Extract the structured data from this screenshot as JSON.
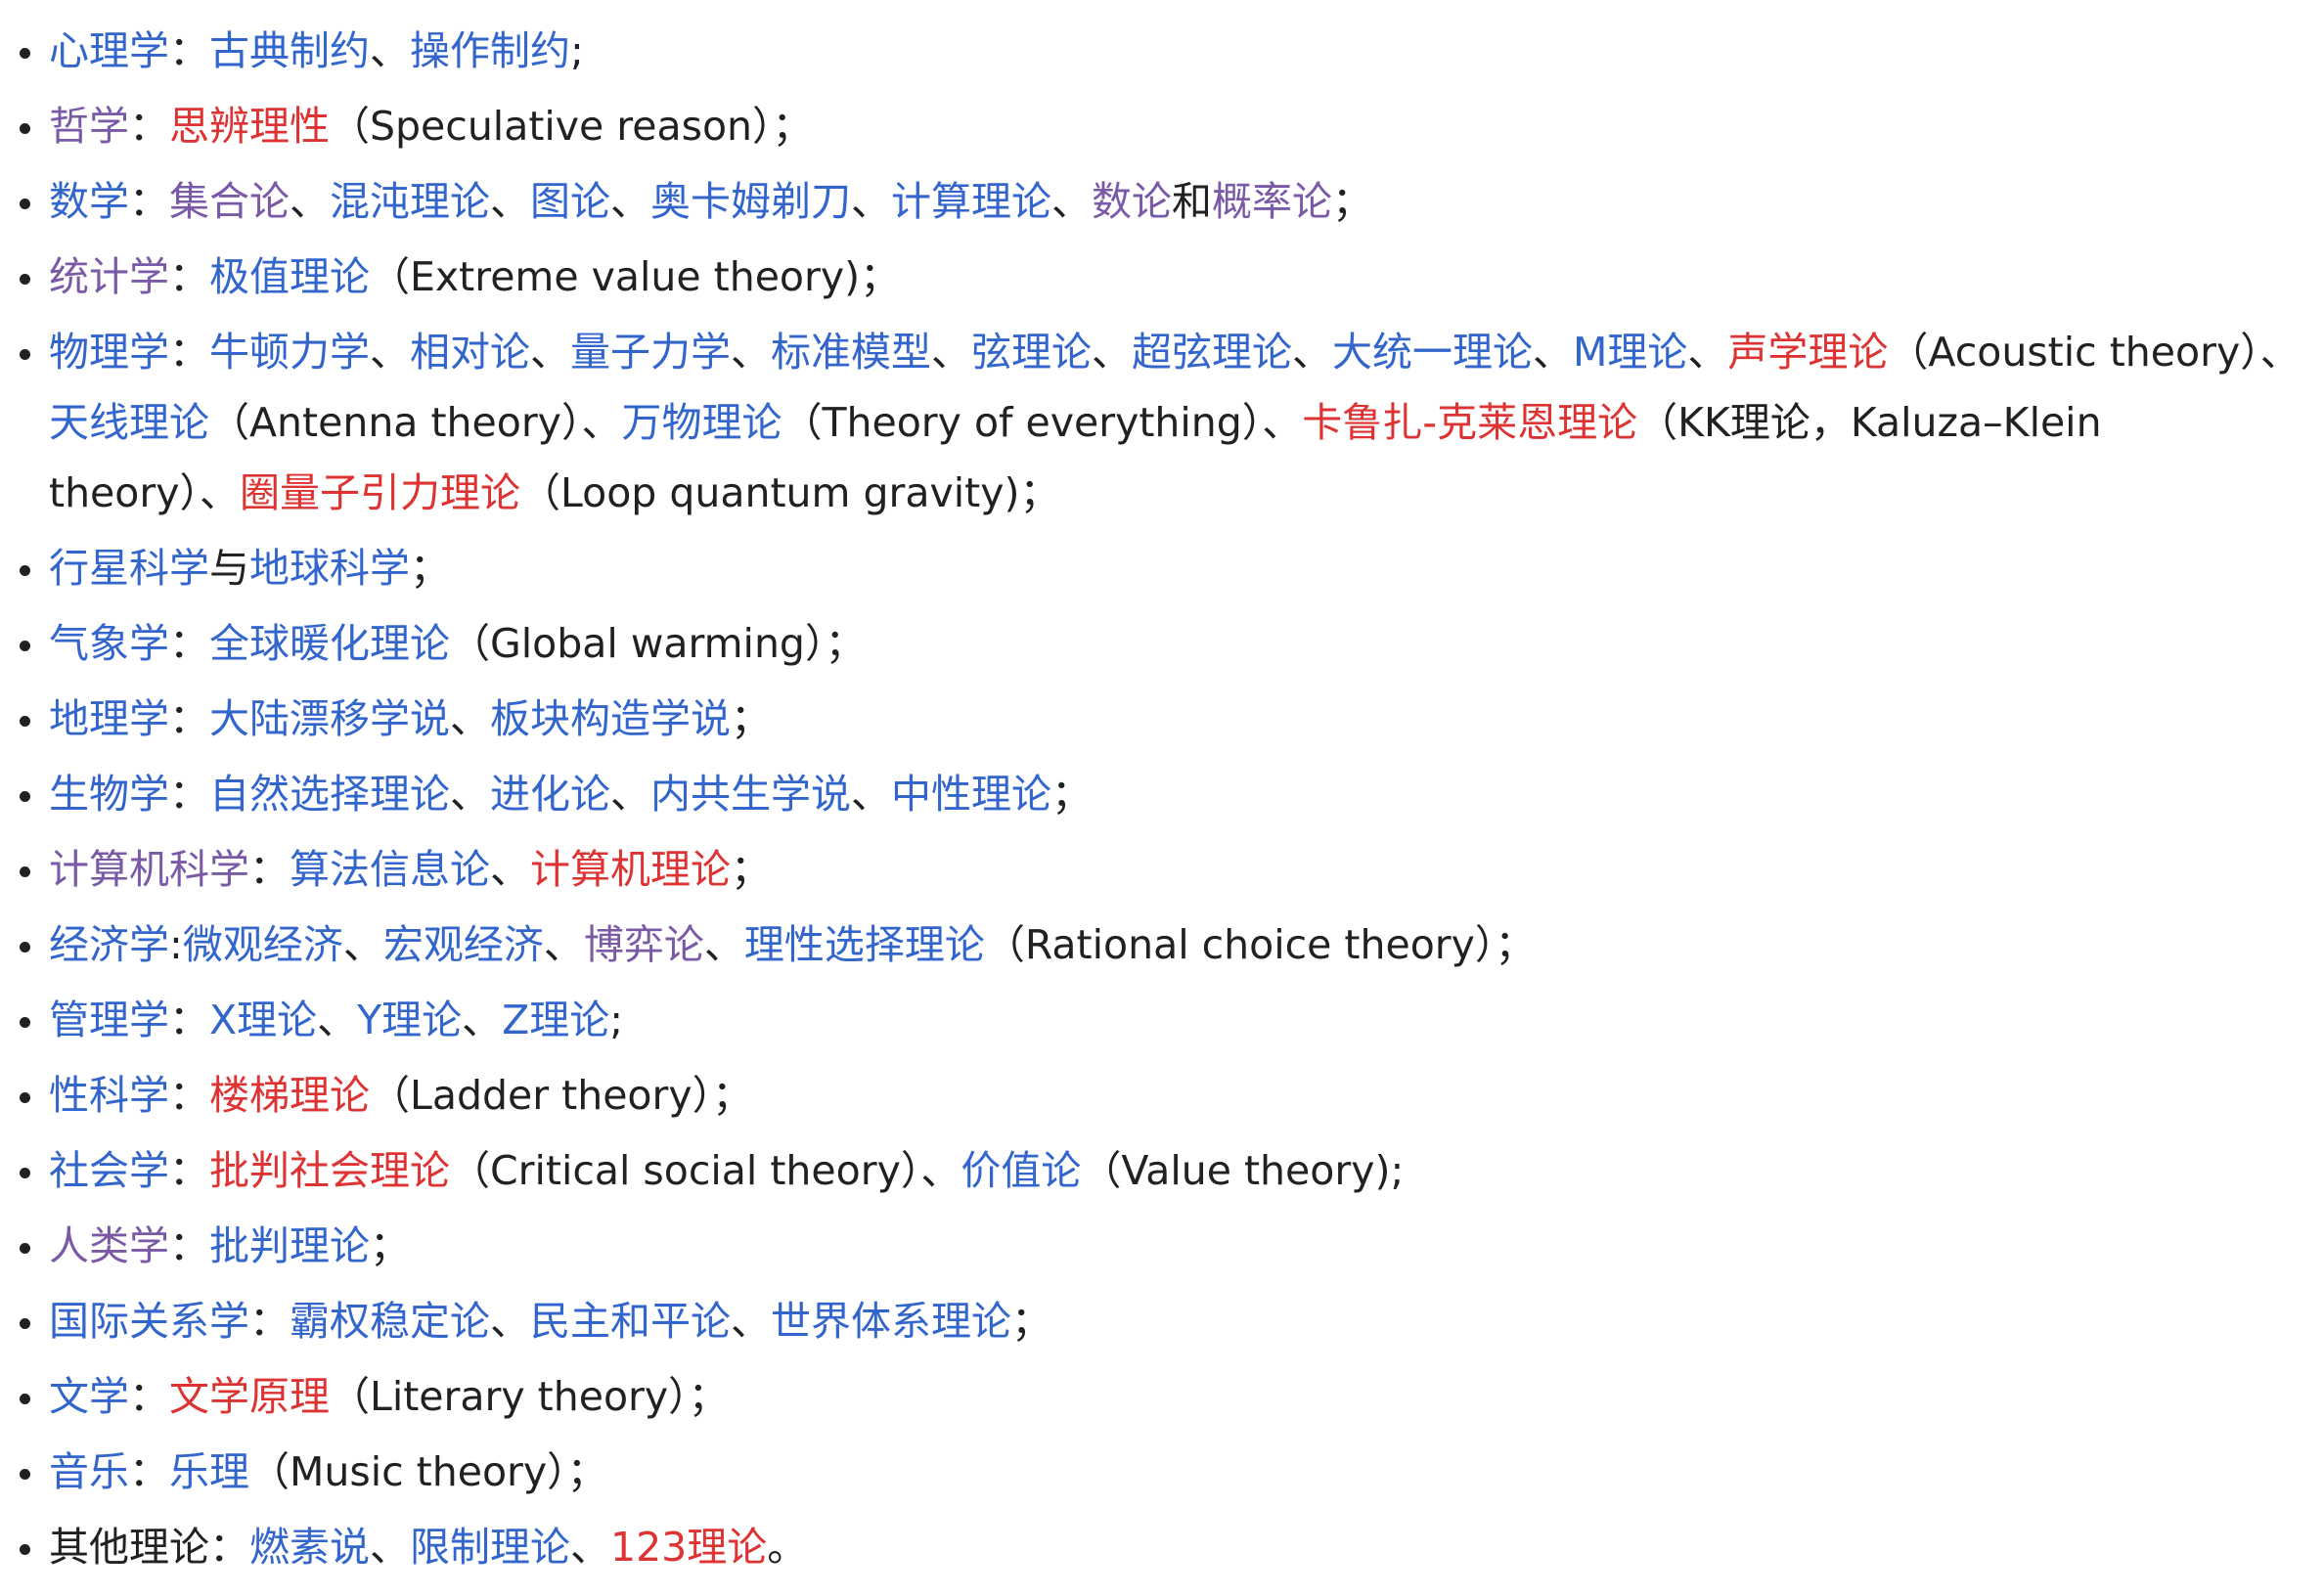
{
  "items": [
    {
      "segments": [
        {
          "text": "心理学",
          "style": "blue",
          "link": true
        },
        {
          "text": "：",
          "style": "plain"
        },
        {
          "text": "古典制约",
          "style": "blue",
          "link": true
        },
        {
          "text": "、",
          "style": "plain"
        },
        {
          "text": "操作制约",
          "style": "blue",
          "link": true
        },
        {
          "text": ";",
          "style": "plain"
        }
      ]
    },
    {
      "segments": [
        {
          "text": "哲学",
          "style": "purple",
          "link": true
        },
        {
          "text": "：",
          "style": "plain"
        },
        {
          "text": "思辨理性",
          "style": "red",
          "link": true
        },
        {
          "text": "（Speculative reason）；",
          "style": "plain"
        }
      ]
    },
    {
      "segments": [
        {
          "text": "数学",
          "style": "blue",
          "link": true
        },
        {
          "text": "：",
          "style": "plain"
        },
        {
          "text": "集合论",
          "style": "purple",
          "link": true
        },
        {
          "text": "、",
          "style": "plain"
        },
        {
          "text": "混沌理论",
          "style": "blue",
          "link": true
        },
        {
          "text": "、",
          "style": "plain"
        },
        {
          "text": "图论",
          "style": "blue",
          "link": true
        },
        {
          "text": "、",
          "style": "plain"
        },
        {
          "text": "奥卡姆剃刀",
          "style": "blue",
          "link": true
        },
        {
          "text": "、",
          "style": "plain"
        },
        {
          "text": "计算理论",
          "style": "blue",
          "link": true
        },
        {
          "text": "、",
          "style": "plain"
        },
        {
          "text": "数论",
          "style": "purple",
          "link": true
        },
        {
          "text": "和",
          "style": "plain"
        },
        {
          "text": "概率论",
          "style": "purple",
          "link": true
        },
        {
          "text": "；",
          "style": "plain"
        }
      ]
    },
    {
      "segments": [
        {
          "text": "统计学",
          "style": "purple",
          "link": true
        },
        {
          "text": "：",
          "style": "plain"
        },
        {
          "text": "极值理论",
          "style": "blue",
          "link": true
        },
        {
          "text": "（Extreme value theory)；",
          "style": "plain"
        }
      ]
    },
    {
      "segments": [
        {
          "text": "物理学",
          "style": "blue",
          "link": true
        },
        {
          "text": "：",
          "style": "plain"
        },
        {
          "text": "牛顿力学",
          "style": "blue",
          "link": true
        },
        {
          "text": "、",
          "style": "plain"
        },
        {
          "text": "相对论",
          "style": "blue",
          "link": true
        },
        {
          "text": "、",
          "style": "plain"
        },
        {
          "text": "量子力学",
          "style": "blue",
          "link": true
        },
        {
          "text": "、",
          "style": "plain"
        },
        {
          "text": "标准模型",
          "style": "blue",
          "link": true
        },
        {
          "text": "、",
          "style": "plain"
        },
        {
          "text": "弦理论",
          "style": "blue",
          "link": true
        },
        {
          "text": "、",
          "style": "plain"
        },
        {
          "text": "超弦理论",
          "style": "blue",
          "link": true
        },
        {
          "text": "、",
          "style": "plain"
        },
        {
          "text": "大统一理论",
          "style": "blue",
          "link": true
        },
        {
          "text": "、",
          "style": "plain"
        },
        {
          "text": "M理论",
          "style": "blue",
          "link": true
        },
        {
          "text": "、",
          "style": "plain"
        },
        {
          "text": "声学理论",
          "style": "red",
          "link": true
        },
        {
          "text": "（Acoustic theory）、",
          "style": "plain"
        },
        {
          "text": "天线理论",
          "style": "blue",
          "link": true
        },
        {
          "text": "（Antenna theory）、",
          "style": "plain"
        },
        {
          "text": "万物理论",
          "style": "blue",
          "link": true
        },
        {
          "text": "（Theory of everything）、",
          "style": "plain"
        },
        {
          "text": "卡鲁扎-克莱恩理论",
          "style": "red",
          "link": true
        },
        {
          "text": "（KK理论，Kaluza–Klein theory）、",
          "style": "plain"
        },
        {
          "text": "圈量子引力理论",
          "style": "red",
          "link": true
        },
        {
          "text": "（Loop quantum gravity)；",
          "style": "plain"
        }
      ]
    },
    {
      "segments": [
        {
          "text": "行星科学",
          "style": "blue",
          "link": true
        },
        {
          "text": "与",
          "style": "plain"
        },
        {
          "text": "地球科学",
          "style": "blue",
          "link": true
        },
        {
          "text": "；",
          "style": "plain"
        }
      ]
    },
    {
      "segments": [
        {
          "text": "气象学",
          "style": "blue",
          "link": true
        },
        {
          "text": "：",
          "style": "plain"
        },
        {
          "text": "全球暖化理论",
          "style": "blue",
          "link": true
        },
        {
          "text": "（Global warming）；",
          "style": "plain"
        }
      ]
    },
    {
      "segments": [
        {
          "text": "地理学",
          "style": "blue",
          "link": true
        },
        {
          "text": "：",
          "style": "plain"
        },
        {
          "text": "大陆漂移学说",
          "style": "blue",
          "link": true
        },
        {
          "text": "、",
          "style": "plain"
        },
        {
          "text": "板块构造学说",
          "style": "blue",
          "link": true
        },
        {
          "text": "；",
          "style": "plain"
        }
      ]
    },
    {
      "segments": [
        {
          "text": "生物学",
          "style": "blue",
          "link": true
        },
        {
          "text": "：",
          "style": "plain"
        },
        {
          "text": "自然选择理论",
          "style": "blue",
          "link": true
        },
        {
          "text": "、",
          "style": "plain"
        },
        {
          "text": "进化论",
          "style": "blue",
          "link": true
        },
        {
          "text": "、",
          "style": "plain"
        },
        {
          "text": "内共生学说",
          "style": "blue",
          "link": true
        },
        {
          "text": "、",
          "style": "plain"
        },
        {
          "text": "中性理论",
          "style": "blue",
          "link": true
        },
        {
          "text": "；",
          "style": "plain"
        }
      ]
    },
    {
      "segments": [
        {
          "text": "计算机科学",
          "style": "purple",
          "link": true
        },
        {
          "text": "：",
          "style": "plain"
        },
        {
          "text": "算法信息论",
          "style": "blue",
          "link": true
        },
        {
          "text": "、",
          "style": "plain"
        },
        {
          "text": "计算机理论",
          "style": "red",
          "link": true
        },
        {
          "text": "；",
          "style": "plain"
        }
      ]
    },
    {
      "segments": [
        {
          "text": "经济学",
          "style": "blue",
          "link": true
        },
        {
          "text": ":",
          "style": "plain"
        },
        {
          "text": "微观经济",
          "style": "blue",
          "link": true
        },
        {
          "text": "、",
          "style": "plain"
        },
        {
          "text": "宏观经济",
          "style": "blue",
          "link": true
        },
        {
          "text": "、",
          "style": "plain"
        },
        {
          "text": "博弈论",
          "style": "purple",
          "link": true
        },
        {
          "text": "、",
          "style": "plain"
        },
        {
          "text": "理性选择理论",
          "style": "blue",
          "link": true
        },
        {
          "text": "（Rational choice theory）；",
          "style": "plain"
        }
      ]
    },
    {
      "segments": [
        {
          "text": "管理学",
          "style": "blue",
          "link": true
        },
        {
          "text": "：",
          "style": "plain"
        },
        {
          "text": "X理论",
          "style": "blue",
          "link": true
        },
        {
          "text": "、",
          "style": "plain"
        },
        {
          "text": "Y理论",
          "style": "blue",
          "link": true
        },
        {
          "text": "、",
          "style": "plain"
        },
        {
          "text": "Z理论",
          "style": "blue",
          "link": true
        },
        {
          "text": ";",
          "style": "plain"
        }
      ]
    },
    {
      "segments": [
        {
          "text": "性科学",
          "style": "blue",
          "link": true
        },
        {
          "text": "：",
          "style": "plain"
        },
        {
          "text": "楼梯理论",
          "style": "red",
          "link": true
        },
        {
          "text": "（Ladder theory）；",
          "style": "plain"
        }
      ]
    },
    {
      "segments": [
        {
          "text": "社会学",
          "style": "blue",
          "link": true
        },
        {
          "text": "：",
          "style": "plain"
        },
        {
          "text": "批判社会理论",
          "style": "red",
          "link": true
        },
        {
          "text": "（Critical social theory）、",
          "style": "plain"
        },
        {
          "text": "价值论",
          "style": "blue",
          "link": true
        },
        {
          "text": "（Value theory);",
          "style": "plain"
        }
      ]
    },
    {
      "segments": [
        {
          "text": "人类学",
          "style": "purple",
          "link": true
        },
        {
          "text": "：",
          "style": "plain"
        },
        {
          "text": "批判理论",
          "style": "blue",
          "link": true
        },
        {
          "text": "；",
          "style": "plain"
        }
      ]
    },
    {
      "segments": [
        {
          "text": "国际关系学",
          "style": "blue",
          "link": true
        },
        {
          "text": "：",
          "style": "plain"
        },
        {
          "text": "霸权稳定论",
          "style": "blue",
          "link": true
        },
        {
          "text": "、",
          "style": "plain"
        },
        {
          "text": "民主和平论",
          "style": "blue",
          "link": true
        },
        {
          "text": "、",
          "style": "plain"
        },
        {
          "text": "世界体系理论",
          "style": "blue",
          "link": true
        },
        {
          "text": "；",
          "style": "plain"
        }
      ]
    },
    {
      "segments": [
        {
          "text": "文学",
          "style": "blue",
          "link": true
        },
        {
          "text": "：",
          "style": "plain"
        },
        {
          "text": "文学原理",
          "style": "red",
          "link": true
        },
        {
          "text": "（Literary theory）；",
          "style": "plain"
        }
      ]
    },
    {
      "segments": [
        {
          "text": "音乐",
          "style": "blue",
          "link": true
        },
        {
          "text": "：",
          "style": "plain"
        },
        {
          "text": "乐理",
          "style": "blue",
          "link": true
        },
        {
          "text": "（Music theory）；",
          "style": "plain"
        }
      ]
    },
    {
      "segments": [
        {
          "text": "其他理论",
          "style": "plain"
        },
        {
          "text": "：",
          "style": "plain"
        },
        {
          "text": "燃素说",
          "style": "blue",
          "link": true
        },
        {
          "text": "、",
          "style": "plain"
        },
        {
          "text": "限制理论",
          "style": "blue",
          "link": true
        },
        {
          "text": "、",
          "style": "plain"
        },
        {
          "text": "123理论",
          "style": "red",
          "link": true
        },
        {
          "text": "。",
          "style": "plain"
        }
      ]
    }
  ]
}
